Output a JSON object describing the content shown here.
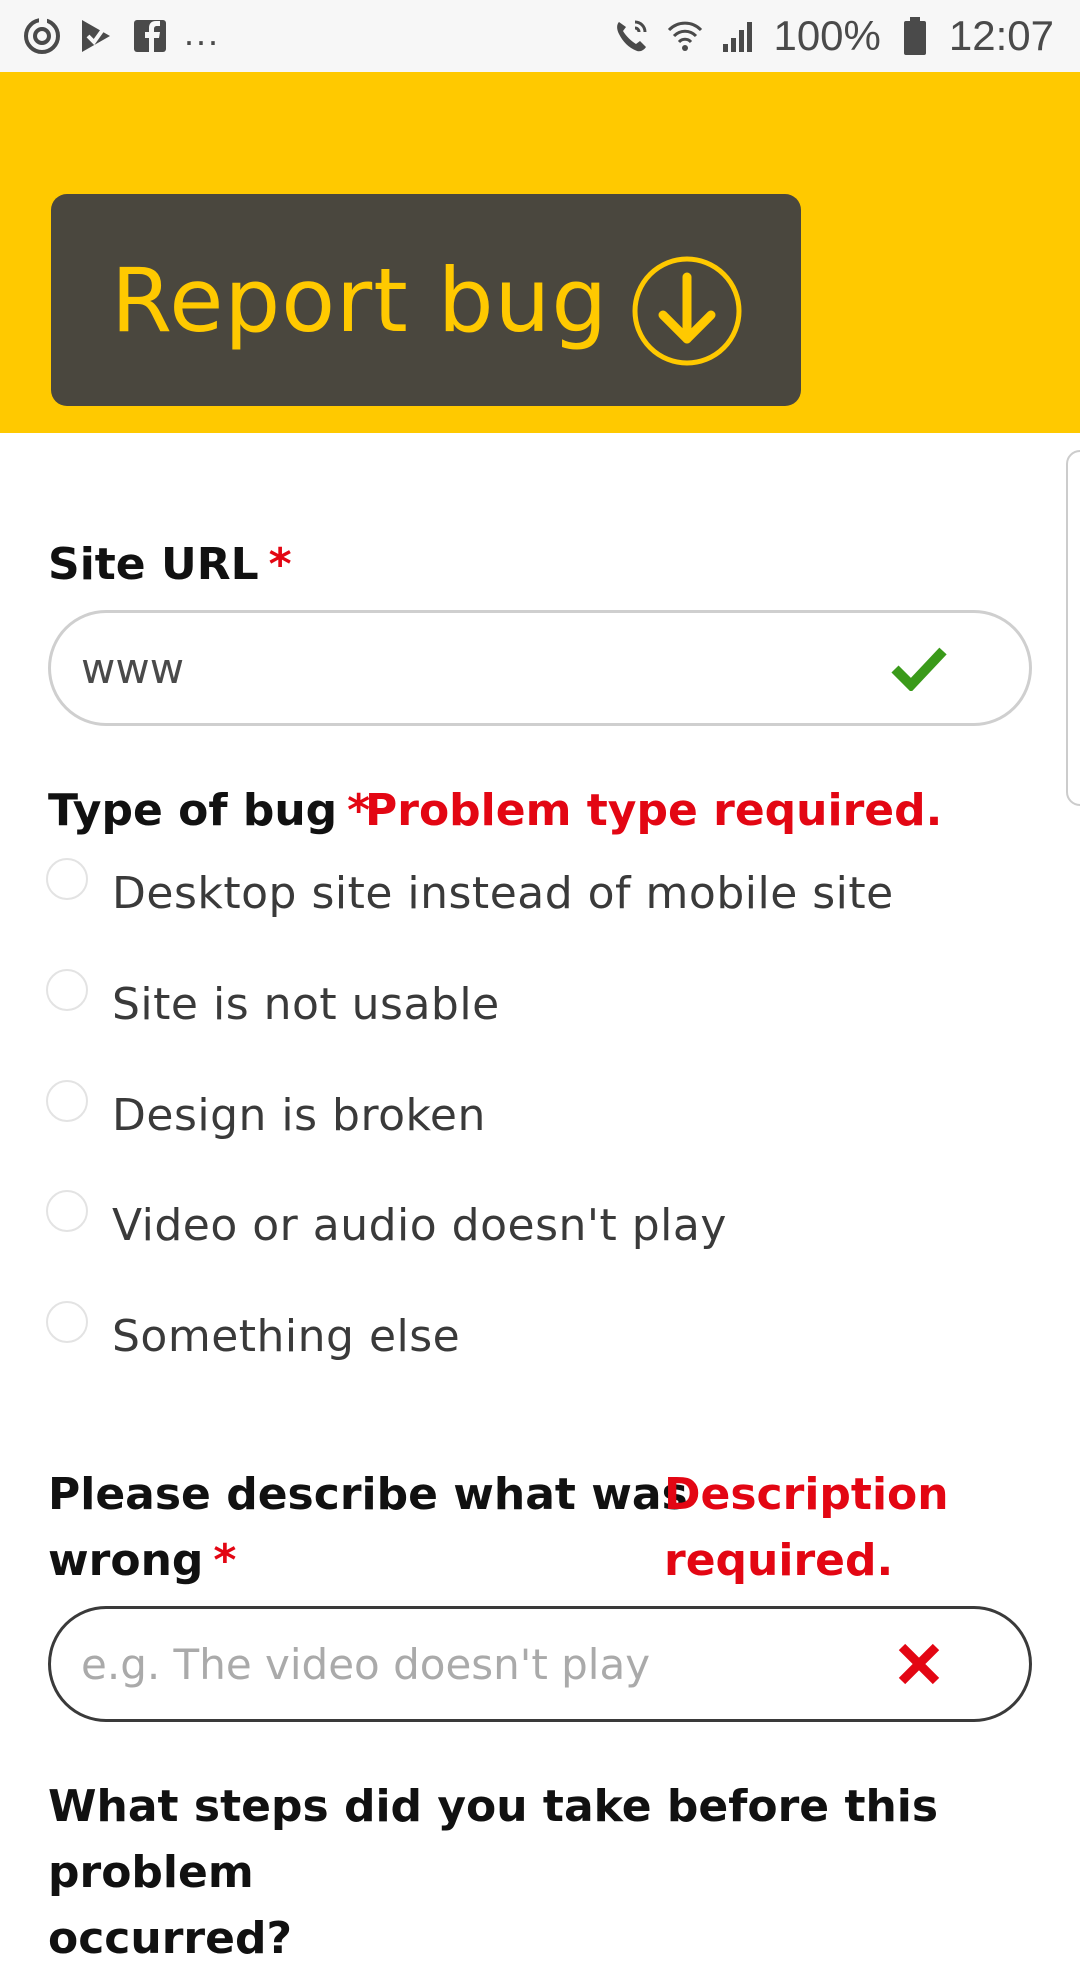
{
  "status_bar": {
    "left_icons": [
      "sync-icon",
      "check-flag-icon",
      "facebook-icon"
    ],
    "overflow": "...",
    "battery": "100%",
    "time": "12:07"
  },
  "header": {
    "button_label": "Report bug",
    "button_icon": "arrow-down-circle-icon",
    "banner_color": "#ffc900",
    "button_color": "#4a473e"
  },
  "form": {
    "site_url": {
      "label": "Site URL",
      "required_mark": "*",
      "value": "www",
      "status_icon": "checkmark-icon"
    },
    "bug_type": {
      "label": "Type of bug",
      "required_mark": "*",
      "error": "Problem type required.",
      "options": [
        "Desktop site instead of mobile site",
        "Site is not usable",
        "Design is broken",
        "Video or audio doesn't play",
        "Something else"
      ]
    },
    "description": {
      "label_line1": "Please describe what was",
      "label_line2": "wrong",
      "required_mark": "*",
      "error_line1": "Description",
      "error_line2": "required.",
      "placeholder": "e.g. The video doesn't play",
      "status_icon": "x-icon"
    },
    "steps": {
      "label_line1": "What steps did you take before this problem",
      "label_line2": "occurred?"
    }
  }
}
